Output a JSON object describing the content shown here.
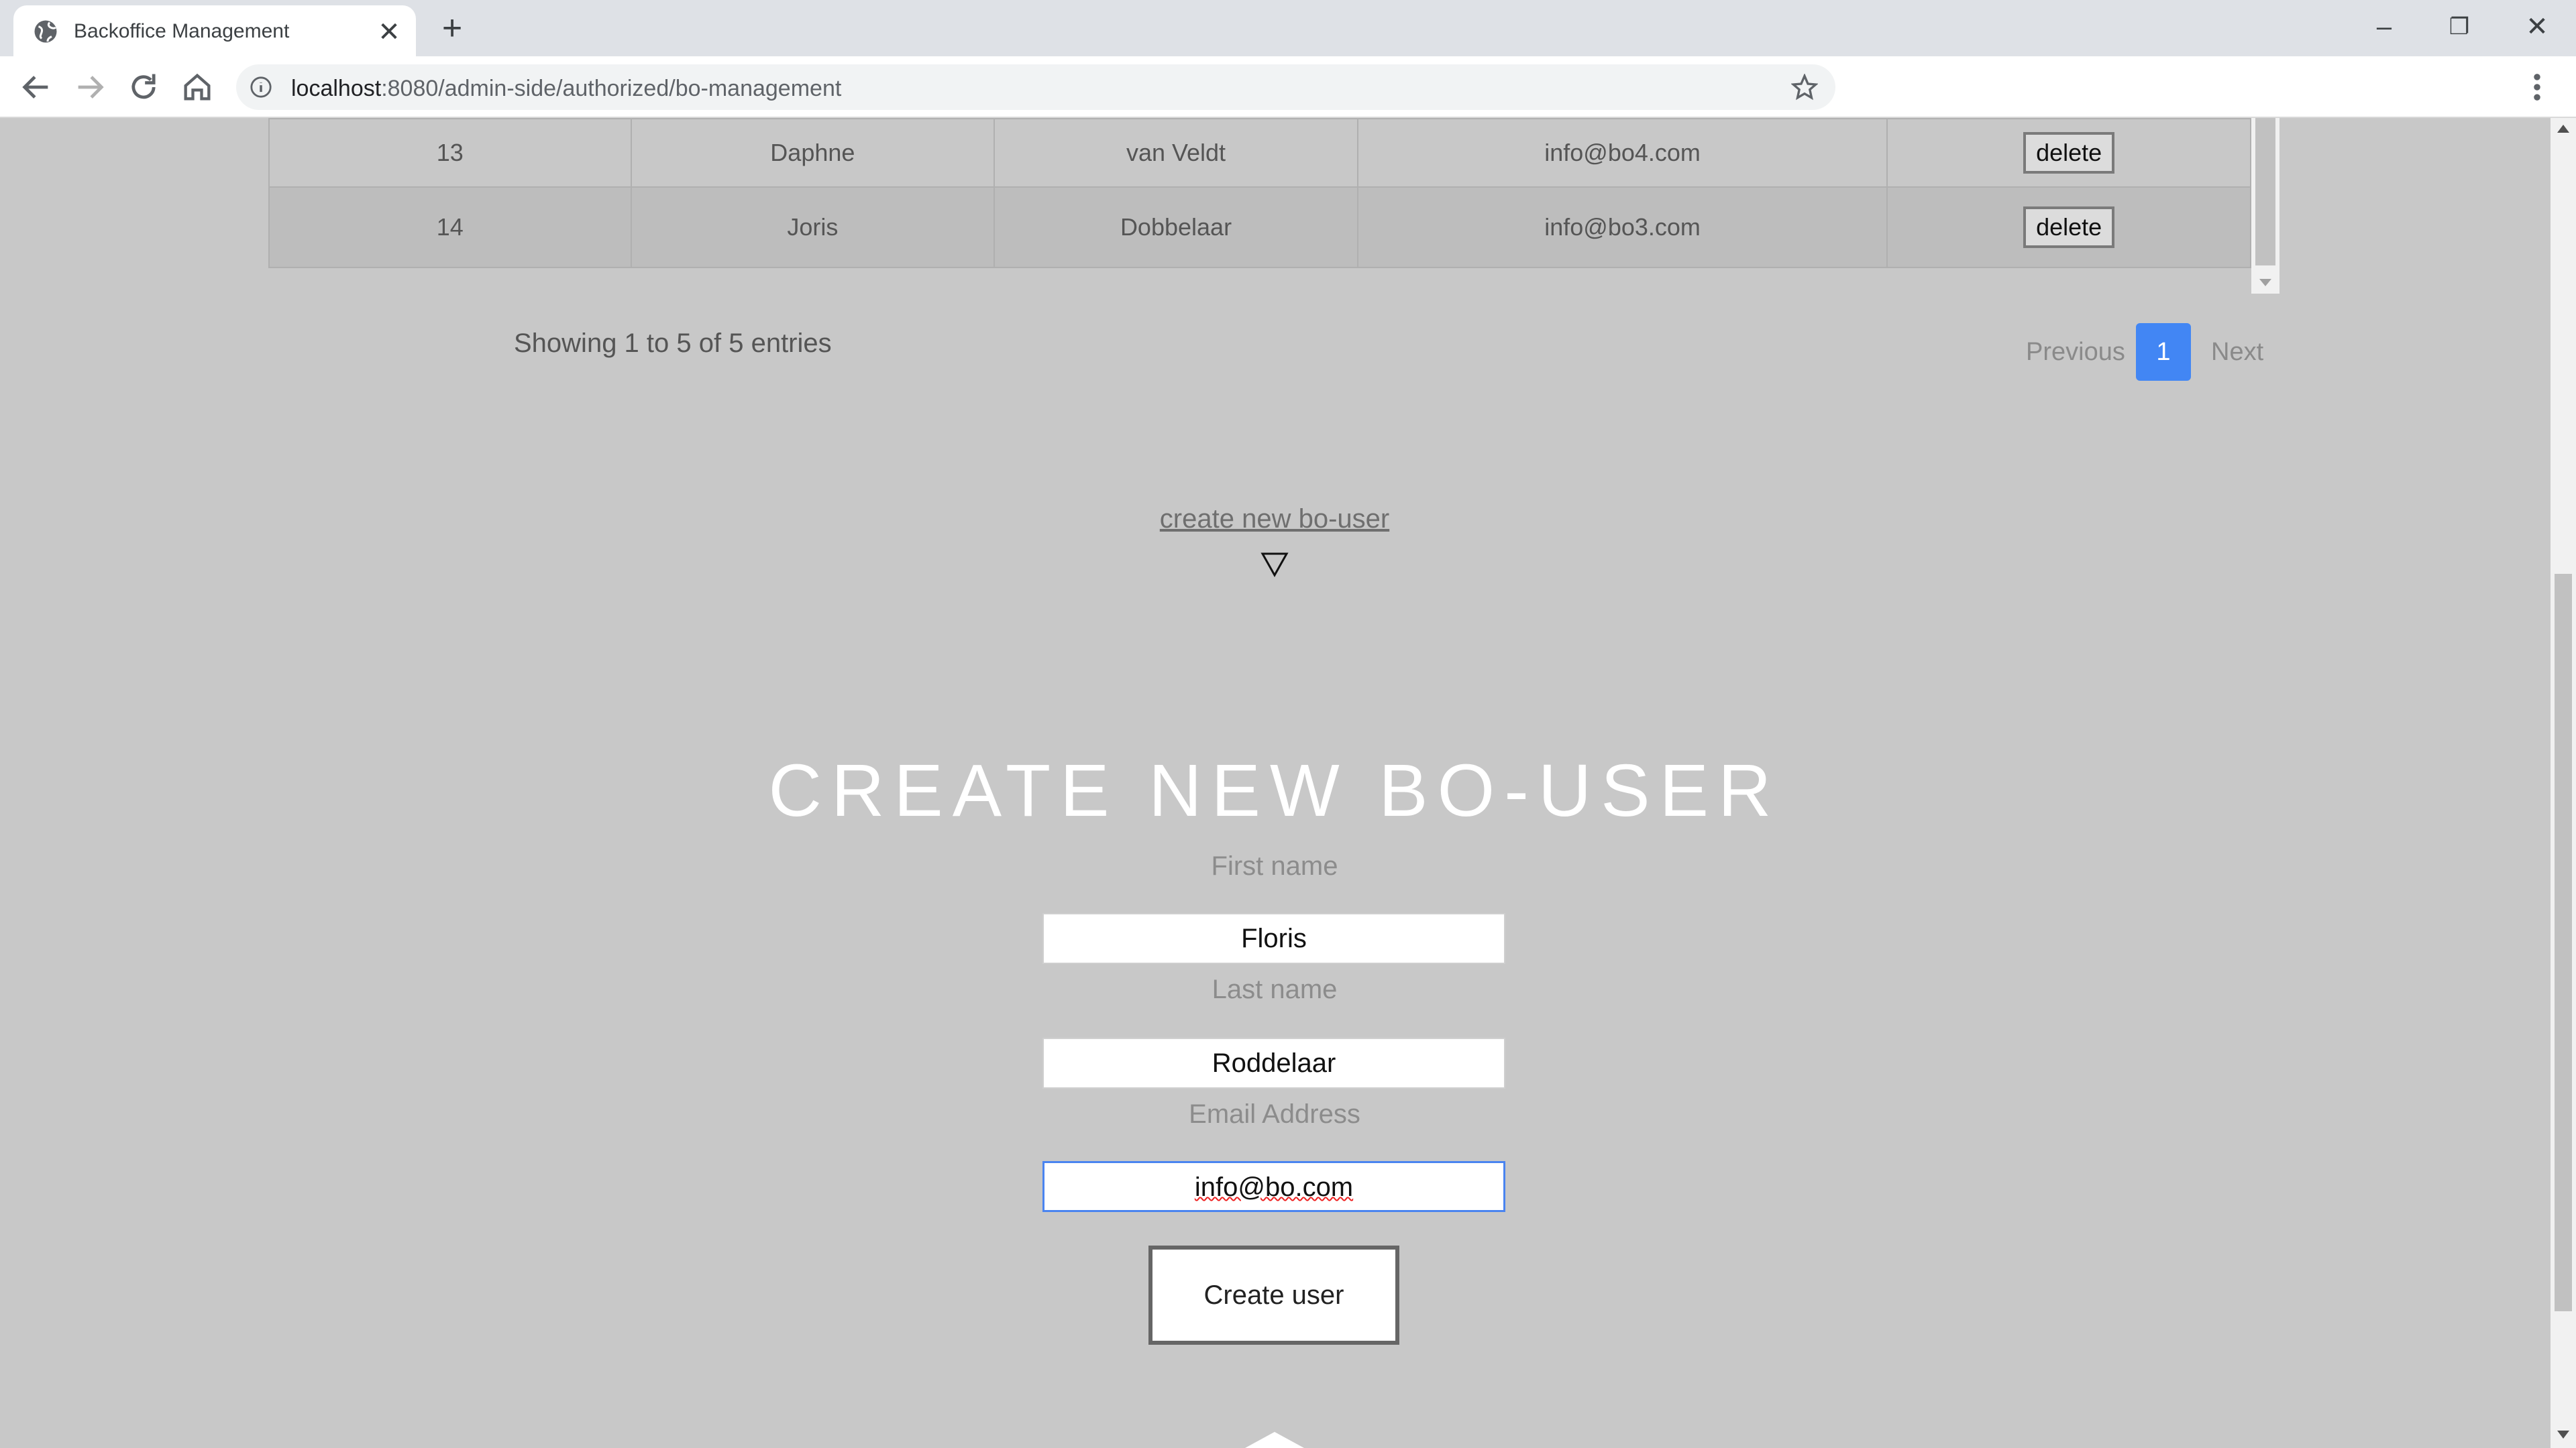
{
  "browser": {
    "tab_title": "Backoffice Management",
    "new_tab_symbol": "+",
    "close_symbol": "✕",
    "url_host": "localhost",
    "url_path": ":8080/admin-side/authorized/bo-management",
    "window": {
      "minimize": "–",
      "maximize": "❐",
      "close": "✕"
    }
  },
  "table": {
    "rows": [
      {
        "id": "13",
        "first_name": "Daphne",
        "last_name": "van Veldt",
        "email": "info@bo4.com",
        "action": "delete"
      },
      {
        "id": "14",
        "first_name": "Joris",
        "last_name": "Dobbelaar",
        "email": "info@bo3.com",
        "action": "delete"
      }
    ],
    "showing_text": "Showing 1 to 5 of 5 entries",
    "pagination": {
      "previous": "Previous",
      "current_page": "1",
      "next": "Next"
    }
  },
  "create_link": "create new bo-user",
  "form": {
    "title": "CREATE NEW BO-USER",
    "first_name_label": "First name",
    "first_name_value": "Floris",
    "last_name_label": "Last name",
    "last_name_value": "Roddelaar",
    "email_label": "Email Address",
    "email_value": "info@bo.com",
    "submit_label": "Create user"
  },
  "colors": {
    "page_bg": "#c8c8c8",
    "accent": "#4286f4",
    "title": "#ffffff"
  }
}
